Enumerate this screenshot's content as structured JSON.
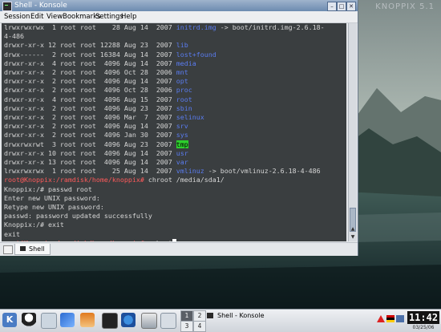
{
  "desktop": {
    "watermark": "KNOPPIX 5.1"
  },
  "window": {
    "title": "Shell - Konsole",
    "menu": [
      "Session",
      "Edit",
      "View",
      "Bookmarks",
      "Settings",
      "Help"
    ]
  },
  "terminal": {
    "lines": [
      [
        {
          "t": "lrwxrwxrwx  1 root root    28 Aug 14  2007 "
        },
        {
          "t": "initrd.img",
          "c": "blue"
        },
        {
          "t": " -> boot/initrd.img-2.6.18-"
        }
      ],
      [
        {
          "t": "4-486"
        }
      ],
      [
        {
          "t": "drwxr-xr-x 12 root root 12288 Aug 23  2007 "
        },
        {
          "t": "lib",
          "c": "blue"
        }
      ],
      [
        {
          "t": "drwx------  2 root root 16384 Aug 14  2007 "
        },
        {
          "t": "lost+found",
          "c": "blue"
        }
      ],
      [
        {
          "t": "drwxr-xr-x  4 root root  4096 Aug 14  2007 "
        },
        {
          "t": "media",
          "c": "blue"
        }
      ],
      [
        {
          "t": "drwxr-xr-x  2 root root  4096 Oct 28  2006 "
        },
        {
          "t": "mnt",
          "c": "blue"
        }
      ],
      [
        {
          "t": "drwxr-xr-x  2 root root  4096 Aug 14  2007 "
        },
        {
          "t": "opt",
          "c": "blue"
        }
      ],
      [
        {
          "t": "drwxr-xr-x  2 root root  4096 Oct 28  2006 "
        },
        {
          "t": "proc",
          "c": "blue"
        }
      ],
      [
        {
          "t": "drwxr-xr-x  4 root root  4096 Aug 15  2007 "
        },
        {
          "t": "root",
          "c": "blue"
        }
      ],
      [
        {
          "t": "drwxr-xr-x  2 root root  4096 Aug 23  2007 "
        },
        {
          "t": "sbin",
          "c": "blue"
        }
      ],
      [
        {
          "t": "drwxr-xr-x  2 root root  4096 Mar  7  2007 "
        },
        {
          "t": "selinux",
          "c": "blue"
        }
      ],
      [
        {
          "t": "drwxr-xr-x  2 root root  4096 Aug 14  2007 "
        },
        {
          "t": "srv",
          "c": "blue"
        }
      ],
      [
        {
          "t": "drwxr-xr-x  2 root root  4096 Jan 30  2007 "
        },
        {
          "t": "sys",
          "c": "blue"
        }
      ],
      [
        {
          "t": "drwxrwxrwt  3 root root  4096 Aug 23  2007 "
        },
        {
          "t": "tmp",
          "c": "hl"
        }
      ],
      [
        {
          "t": "drwxr-xr-x 10 root root  4096 Aug 14  2007 "
        },
        {
          "t": "usr",
          "c": "blue"
        }
      ],
      [
        {
          "t": "drwxr-xr-x 13 root root  4096 Aug 14  2007 "
        },
        {
          "t": "var",
          "c": "blue"
        }
      ],
      [
        {
          "t": "lrwxrwxrwx  1 root root    25 Aug 14  2007 "
        },
        {
          "t": "vmlinuz",
          "c": "blue"
        },
        {
          "t": " -> boot/vmlinuz-2.6.18-4-486"
        }
      ],
      [
        {
          "t": "root@Knoppix:/ramdisk/home/knoppix#",
          "c": "red"
        },
        {
          "t": " chroot /media/sda1/"
        }
      ],
      [
        {
          "t": "Knoppix:/# passwd root"
        }
      ],
      [
        {
          "t": "Enter new UNIX password:"
        }
      ],
      [
        {
          "t": "Retype new UNIX password:"
        }
      ],
      [
        {
          "t": "passwd: password updated successfully"
        }
      ],
      [
        {
          "t": "Knoppix:/# exit"
        }
      ],
      [
        {
          "t": "exit"
        }
      ],
      [
        {
          "t": "root@Knoppix:/ramdisk/home/knoppix#",
          "c": "red"
        },
        {
          "t": " reboot"
        }
      ]
    ]
  },
  "tabs": [
    {
      "label": "Shell"
    }
  ],
  "taskbar": {
    "pager": [
      "1",
      "2",
      "3",
      "4"
    ],
    "active_desktop": "1",
    "task": "Shell - Konsole",
    "clock": "11:42",
    "date": "03/25/06"
  }
}
